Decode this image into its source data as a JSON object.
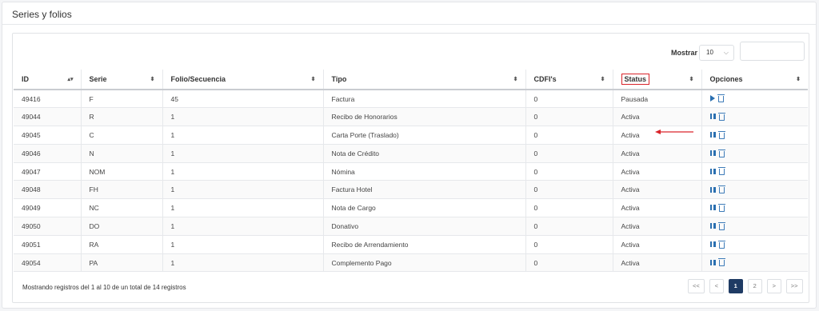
{
  "panel": {
    "title": "Series y folios"
  },
  "controls": {
    "show_label": "Mostrar",
    "show_value": "10"
  },
  "table": {
    "headers": [
      "ID",
      "Serie",
      "Folio/Secuencia",
      "Tipo",
      "CDFI's",
      "Status",
      "Opciones"
    ],
    "rows": [
      {
        "id": "49416",
        "serie": "F",
        "folio": "45",
        "tipo": "Factura",
        "cfdis": "0",
        "status": "Pausada",
        "action": "play-icon"
      },
      {
        "id": "49044",
        "serie": "R",
        "folio": "1",
        "tipo": "Recibo de Honorarios",
        "cfdis": "0",
        "status": "Activa",
        "action": "pause-icon"
      },
      {
        "id": "49045",
        "serie": "C",
        "folio": "1",
        "tipo": "Carta Porte (Traslado)",
        "cfdis": "0",
        "status": "Activa",
        "action": "pause-icon"
      },
      {
        "id": "49046",
        "serie": "N",
        "folio": "1",
        "tipo": "Nota de Crédito",
        "cfdis": "0",
        "status": "Activa",
        "action": "pause-icon"
      },
      {
        "id": "49047",
        "serie": "NOM",
        "folio": "1",
        "tipo": "Nómina",
        "cfdis": "0",
        "status": "Activa",
        "action": "pause-icon"
      },
      {
        "id": "49048",
        "serie": "FH",
        "folio": "1",
        "tipo": "Factura Hotel",
        "cfdis": "0",
        "status": "Activa",
        "action": "pause-icon"
      },
      {
        "id": "49049",
        "serie": "NC",
        "folio": "1",
        "tipo": "Nota de Cargo",
        "cfdis": "0",
        "status": "Activa",
        "action": "pause-icon"
      },
      {
        "id": "49050",
        "serie": "DO",
        "folio": "1",
        "tipo": "Donativo",
        "cfdis": "0",
        "status": "Activa",
        "action": "pause-icon"
      },
      {
        "id": "49051",
        "serie": "RA",
        "folio": "1",
        "tipo": "Recibo de Arrendamiento",
        "cfdis": "0",
        "status": "Activa",
        "action": "pause-icon"
      },
      {
        "id": "49054",
        "serie": "PA",
        "folio": "1",
        "tipo": "Complemento Pago",
        "cfdis": "0",
        "status": "Activa",
        "action": "pause-icon"
      }
    ]
  },
  "footer": {
    "summary": "Mostrando registros del 1 al 10 de un total de 14 registros",
    "pagination": [
      "<<",
      "<",
      "1",
      "2",
      ">",
      ">>"
    ],
    "current_page": "1"
  },
  "colors": {
    "accent": "#1f3b64",
    "icon": "#2a6fb0",
    "highlight": "#d9242a"
  }
}
